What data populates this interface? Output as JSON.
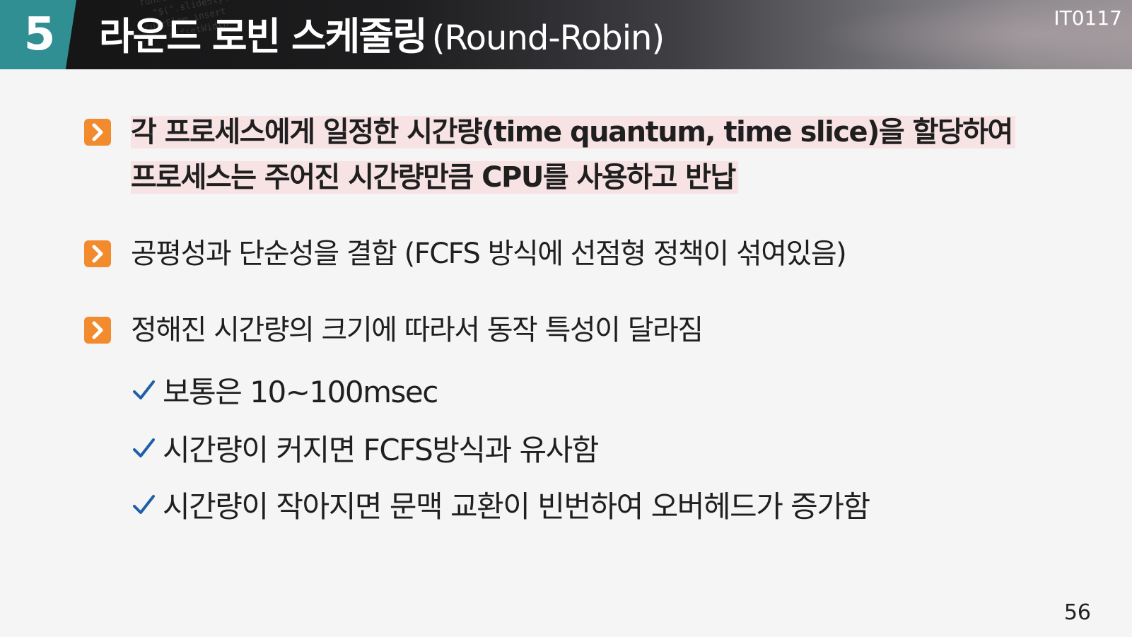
{
  "header": {
    "number": "5",
    "title_ko": "라운드 로빈 스케줄링",
    "title_en": "(Round-Robin)",
    "code": "IT0117"
  },
  "bullets": [
    {
      "icon": "chevron-right-icon",
      "lines": [
        "각 프로세스에게 일정한 시간량(time quantum, time slice)을 할당하여",
        "프로세스는 주어진 시간량만큼 CPU를 사용하고 반납"
      ],
      "emphasis": true
    },
    {
      "icon": "chevron-right-icon",
      "lines": [
        "공평성과 단순성을 결합 (FCFS 방식에 선점형 정책이 섞여있음)"
      ],
      "emphasis": false
    },
    {
      "icon": "chevron-right-icon",
      "lines": [
        "정해진 시간량의 크기에 따라서 동작 특성이 달라짐"
      ],
      "emphasis": false,
      "sub_items": [
        "보통은 10~100msec",
        "시간량이 커지면 FCFS방식과 유사함",
        "시간량이 작아지면 문맥 교환이 빈번하여 오버헤드가 증가함"
      ]
    }
  ],
  "page_number": "56",
  "colors": {
    "accent_teal": "#2f8f93",
    "bullet_orange": "#f28b2e",
    "highlight_pink": "#f7e2e4",
    "check_blue": "#1f5fa8"
  }
}
